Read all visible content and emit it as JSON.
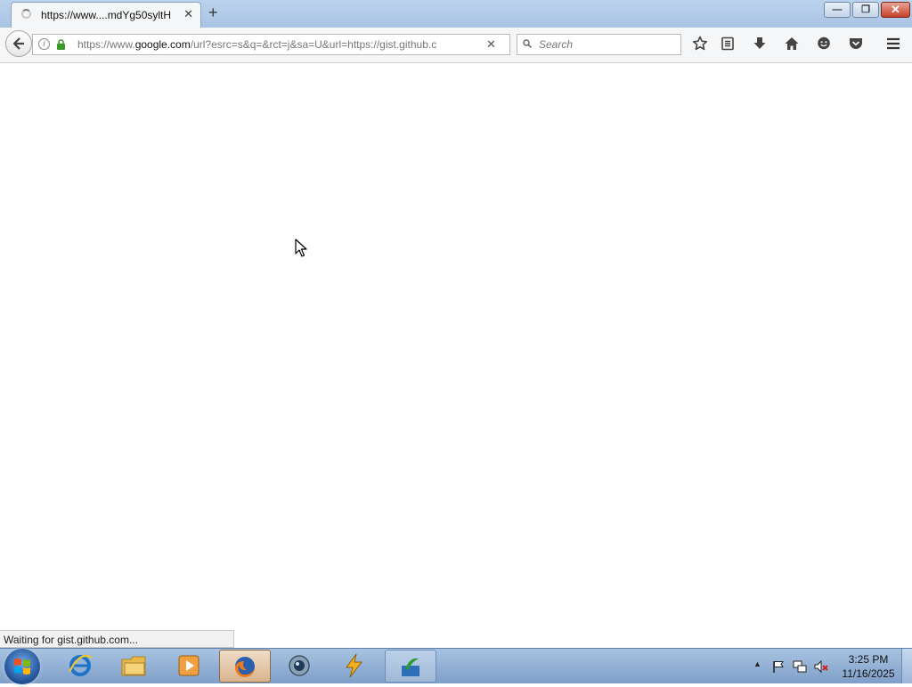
{
  "browser": {
    "tab": {
      "title": "https://www....mdYg50syltH",
      "close_glyph": "✕",
      "loading": true
    },
    "new_tab_glyph": "+",
    "url": {
      "prefix": "https://www.",
      "host": "google.com",
      "path": "/url?esrc=s&q=&rct=j&sa=U&url=https://gist.github.c"
    },
    "stop_glyph": "✕",
    "search": {
      "placeholder": "Search"
    },
    "status": "Waiting for gist.github.com...",
    "toolbar_icons": [
      "star-icon",
      "reading-list-icon",
      "download-icon",
      "home-icon",
      "hello-icon",
      "pocket-icon",
      "menu-icon"
    ]
  },
  "taskbar": {
    "apps": [
      "internet-explorer-icon",
      "file-explorer-icon",
      "media-player-icon",
      "firefox-icon",
      "network-app-icon",
      "winamp-icon",
      "app-icon"
    ],
    "clock": {
      "time": "3:25 PM",
      "date": "11/16/2025"
    }
  },
  "colors": {
    "titlebar": "#a9c3e3",
    "taskbar": "#7f9fc8",
    "lock_green": "#3a9a2a",
    "close_red": "#c6402a"
  }
}
